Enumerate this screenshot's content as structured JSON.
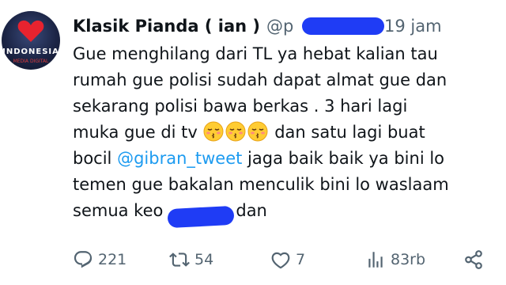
{
  "tweet": {
    "display_name": "Klasik Pianda ( ian )",
    "handle": "@p",
    "time": "19 jam",
    "avatar_text": "INDONESIA",
    "avatar_subtext": "MEDIA DIGITAL",
    "lines": {
      "l1": "Gue menghilang dari TL ya hebat kalian tau",
      "l2": "rumah gue polisi sudah dapat almat gue dan",
      "l3": "sekarang polisi bawa berkas . 3 hari lagi",
      "l4_a": "muka gue di tv",
      "l4_b": " dan satu lagi buat",
      "l5_a": "bocil ",
      "l5_mention": "@gibran_tweet",
      "l5_b": " jaga baik baik ya bini lo",
      "l6": "temen gue bakalan menculik bini lo waslaam",
      "l7_a": "semua keo",
      "l7_b": "dan"
    },
    "emoji_name": "kissing-closed-eyes-emoji",
    "emoji_count": 3,
    "colors": {
      "mention": "#1d9bf0",
      "secondary_text": "#536471",
      "redaction": "#1f3cf5"
    }
  },
  "actions": {
    "reply_count": "221",
    "retweet_count": "54",
    "like_count": "7",
    "views_count": "83rb",
    "icons": [
      "reply-icon",
      "retweet-icon",
      "like-icon",
      "views-icon",
      "share-icon"
    ]
  }
}
